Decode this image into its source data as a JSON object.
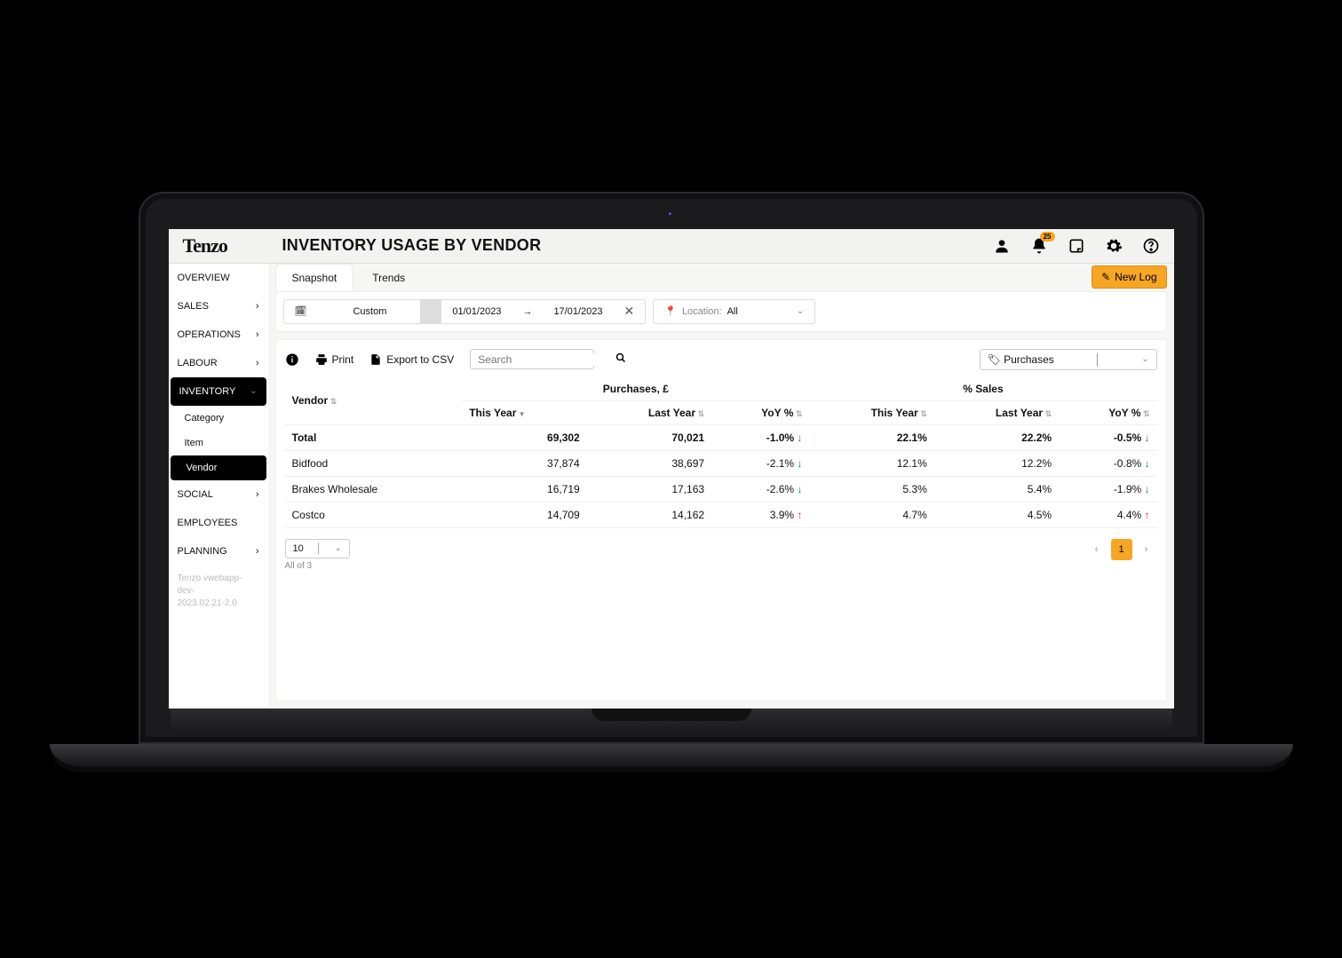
{
  "brand": "Tenzo",
  "page_title": "INVENTORY USAGE BY VENDOR",
  "notification_count": "25",
  "new_log_label": "New Log",
  "sidebar": {
    "items": [
      {
        "label": "OVERVIEW",
        "chevron": false
      },
      {
        "label": "SALES",
        "chevron": true
      },
      {
        "label": "OPERATIONS",
        "chevron": true
      },
      {
        "label": "LABOUR",
        "chevron": true
      },
      {
        "label": "INVENTORY",
        "chevron": true,
        "active": true,
        "subs": [
          {
            "label": "Category"
          },
          {
            "label": "Item"
          },
          {
            "label": "Vendor",
            "active": true
          }
        ]
      },
      {
        "label": "SOCIAL",
        "chevron": true
      },
      {
        "label": "EMPLOYEES",
        "chevron": false
      },
      {
        "label": "PLANNING",
        "chevron": true
      }
    ],
    "version_line1": "Tenzo vwebapp-dev-",
    "version_line2": "2023.02.21-2.0"
  },
  "tabs": [
    {
      "label": "Snapshot",
      "active": true
    },
    {
      "label": "Trends",
      "active": false
    }
  ],
  "filters": {
    "range_label": "Custom",
    "date_from": "01/01/2023",
    "date_to": "17/01/2023",
    "location_label": "Location:",
    "location_value": "All"
  },
  "toolbar": {
    "print": "Print",
    "export": "Export to CSV",
    "search_placeholder": "Search",
    "metric_selected": "Purchases"
  },
  "table": {
    "vendor_header": "Vendor",
    "group_purchases": "Purchases, £",
    "group_sales": "% Sales",
    "cols": [
      "This Year",
      "Last Year",
      "YoY %",
      "This Year",
      "Last Year",
      "YoY %"
    ],
    "rows": [
      {
        "vendor": "Total",
        "p_this": "69,302",
        "p_last": "70,021",
        "p_yoy": "-1.0%",
        "p_dir": "down",
        "s_this": "22.1%",
        "s_last": "22.2%",
        "s_yoy": "-0.5%",
        "s_dir": "down"
      },
      {
        "vendor": "Bidfood",
        "p_this": "37,874",
        "p_last": "38,697",
        "p_yoy": "-2.1%",
        "p_dir": "down",
        "s_this": "12.1%",
        "s_last": "12.2%",
        "s_yoy": "-0.8%",
        "s_dir": "down"
      },
      {
        "vendor": "Brakes Wholesale",
        "p_this": "16,719",
        "p_last": "17,163",
        "p_yoy": "-2.6%",
        "p_dir": "down",
        "s_this": "5.3%",
        "s_last": "5.4%",
        "s_yoy": "-1.9%",
        "s_dir": "down"
      },
      {
        "vendor": "Costco",
        "p_this": "14,709",
        "p_last": "14,162",
        "p_yoy": "3.9%",
        "p_dir": "up",
        "s_this": "4.7%",
        "s_last": "4.5%",
        "s_yoy": "4.4%",
        "s_dir": "up"
      }
    ]
  },
  "pagination": {
    "page_size": "10",
    "summary": "All of 3",
    "current_page": "1"
  }
}
